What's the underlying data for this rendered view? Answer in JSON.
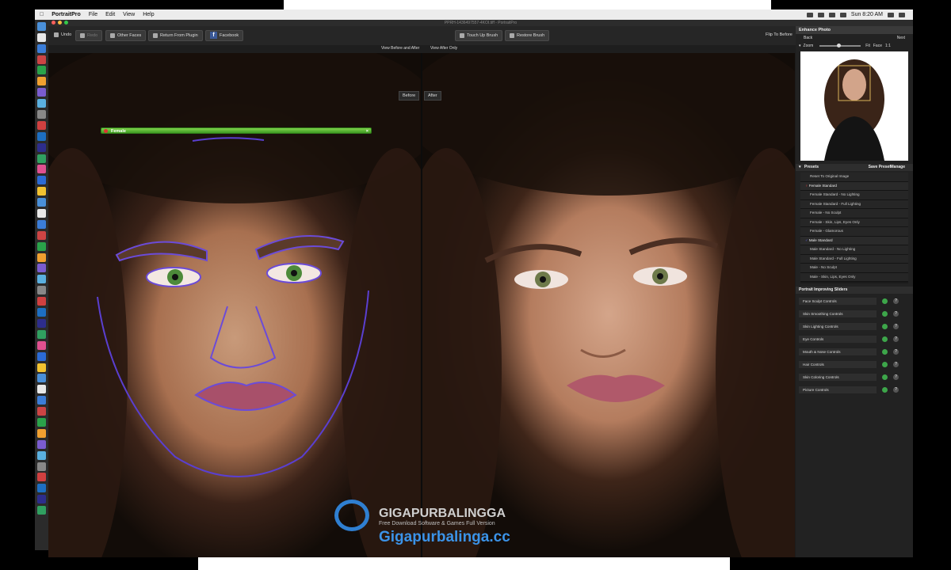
{
  "menubar": {
    "apple": "",
    "app": "PortraitPro",
    "menus": [
      "File",
      "Edit",
      "View",
      "Help"
    ],
    "clock": "Sun 8:20 AM"
  },
  "window": {
    "title": "PPRH-1436497557-4KOI.tiff - PortraitPro"
  },
  "toolbar": {
    "undo": "Undo",
    "redo": "Redo",
    "other_faces": "Other Faces",
    "return_plugin": "Return From Plugin",
    "facebook": "Facebook",
    "touch_up": "Touch Up Brush",
    "restore": "Restore Brush",
    "flip": "Flip To Before"
  },
  "viewbar": {
    "before_after": "View Before and After",
    "after_only": "View After Only"
  },
  "photos": {
    "before_label": "Before",
    "after_label": "After",
    "face_tag": "Female",
    "close": "×"
  },
  "panel": {
    "title": "Enhance Photo",
    "back": "Back",
    "next": "Next",
    "zoom": "Zoom",
    "fit": "Fit",
    "face": "Face",
    "one": "1:1",
    "presets_title": "Presets",
    "save_preset": "Save Preset",
    "manage": "Manage",
    "presets": [
      "Reset To Original Image",
      "Female Standard",
      "Female Standard - No Lighting",
      "Female Standard - Full Lighting",
      "Female - No Sculpt",
      "Female - Skin, Lips, Eyes Only",
      "Female - Glamorous",
      "Male Standard",
      "Male Standard - No Lighting",
      "Male Standard - Full Lighting",
      "Male - No Sculpt",
      "Male - Skin, Lips, Eyes Only"
    ],
    "sliders_title": "Portrait Improving Sliders",
    "controls": [
      "Face Sculpt Controls",
      "Skin Smoothing Controls",
      "Skin Lighting Controls",
      "Eye Controls",
      "Mouth & Nose Controls",
      "Hair Controls",
      "Skin Coloring Controls",
      "Picture Controls"
    ]
  },
  "watermark": {
    "brand": "GIGAPURBALINGGA",
    "tagline": "Free Download Software & Games Full Version",
    "url": "Gigapurbalinga.cc"
  },
  "colors": {
    "accent_green": "#3e9a22",
    "overlay_purple": "#5a3fd0",
    "watermark_blue": "#3b93e8"
  }
}
